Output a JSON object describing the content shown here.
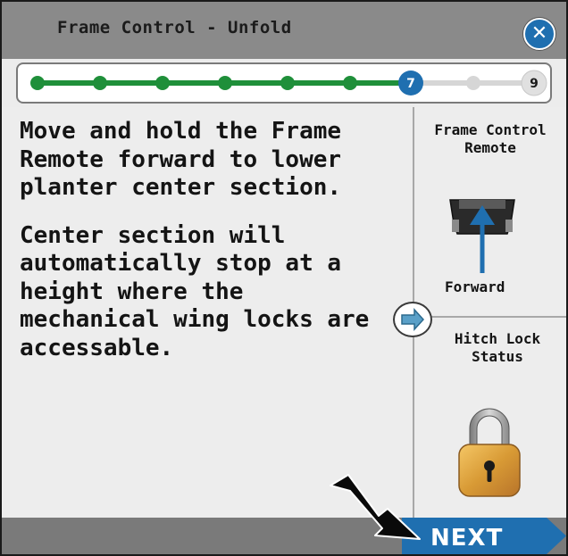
{
  "window": {
    "title": "Frame Control - Unfold",
    "close_icon": "close-icon"
  },
  "progress": {
    "current_step": 7,
    "total_steps": 9,
    "current_label": "7",
    "total_label": "9",
    "fraction_complete": 0.75,
    "done_color": "#1f8f3a",
    "current_color": "#1f6fb0",
    "pending_color": "#cfcfcf"
  },
  "instructions": {
    "paragraph_1": "Move and hold the Frame Remote forward to lower planter center section.",
    "paragraph_2": "Center section will automatically stop at a height where the mechanical wing locks are accessable."
  },
  "side_panel": {
    "remote_title": "Frame Control Remote",
    "remote_direction": "Forward",
    "remote_icon": "frame-remote-icon",
    "hitch_title": "Hitch Lock Status",
    "hitch_icon": "padlock-icon",
    "arrow_icon": "right-arrow-icon"
  },
  "footer": {
    "next_label": "NEXT",
    "next_color": "#1f6fb0"
  },
  "colors": {
    "header": "#8a8a8a",
    "content_bg": "#ededed",
    "accent_blue": "#1f6fb0",
    "progress_green": "#1f8f3a"
  }
}
